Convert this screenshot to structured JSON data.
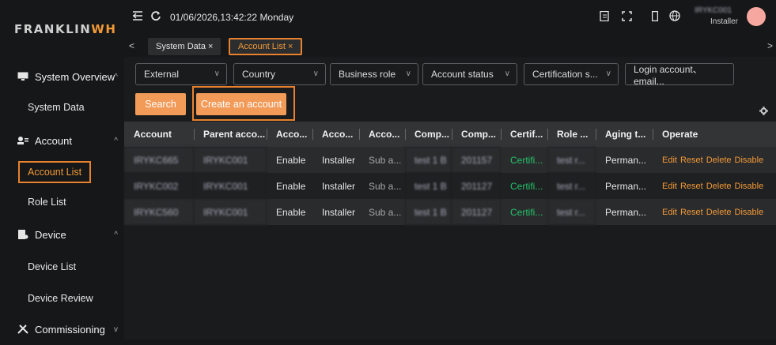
{
  "app": {
    "logo_prefix": "FRANKLIN",
    "logo_suffix": "WH"
  },
  "topbar": {
    "datetime": "01/06/2026,13:42:22 Monday",
    "user_id": "IRYKC001",
    "user_role": "Installer"
  },
  "tabs": [
    {
      "label": "System Data",
      "close": "×"
    },
    {
      "label": "Account List",
      "close": "×"
    }
  ],
  "sidebar": {
    "groups": [
      {
        "label": "System Overview",
        "chev": "^"
      },
      {
        "label": "Account",
        "chev": "^"
      },
      {
        "label": "Device",
        "chev": "^"
      },
      {
        "label": "Commissioning",
        "chev": "v"
      }
    ],
    "items": [
      "System Data",
      "Account List",
      "Role List",
      "Device List",
      "Device Review"
    ]
  },
  "filters": {
    "type": "External",
    "country": "Country",
    "business_role": "Business role",
    "account_status": "Account status",
    "certification": "Certification s...",
    "login_placeholder": "Login account、email..."
  },
  "buttons": {
    "search": "Search",
    "create": "Create an account"
  },
  "table": {
    "headers": [
      "Account",
      "Parent acco...",
      "Acco...",
      "Acco...",
      "Acco...",
      "Comp...",
      "Comp...",
      "Certif...",
      "Role ...",
      "Aging t...",
      "Operate"
    ],
    "rows": [
      [
        "IRYKC665",
        "IRYKC001",
        "Enable",
        "Installer",
        "Sub a...",
        "test 1 B",
        "201157",
        "Certifi...",
        "test r...",
        "Perman..."
      ],
      [
        "IRYKC002",
        "IRYKC001",
        "Enable",
        "Installer",
        "Sub a...",
        "test 1 B",
        "201127",
        "Certifi...",
        "test r...",
        "Perman..."
      ],
      [
        "IRYKC560",
        "IRYKC001",
        "Enable",
        "Installer",
        "Sub a...",
        "test 1 B",
        "201127",
        "Certifi...",
        "test r...",
        "Perman..."
      ]
    ],
    "operations": [
      "Edit",
      "Reset",
      "Delete",
      "Disable"
    ]
  },
  "colors": {
    "accent": "#f29a38",
    "highlight": "#e8822f",
    "green": "#25c46a"
  }
}
